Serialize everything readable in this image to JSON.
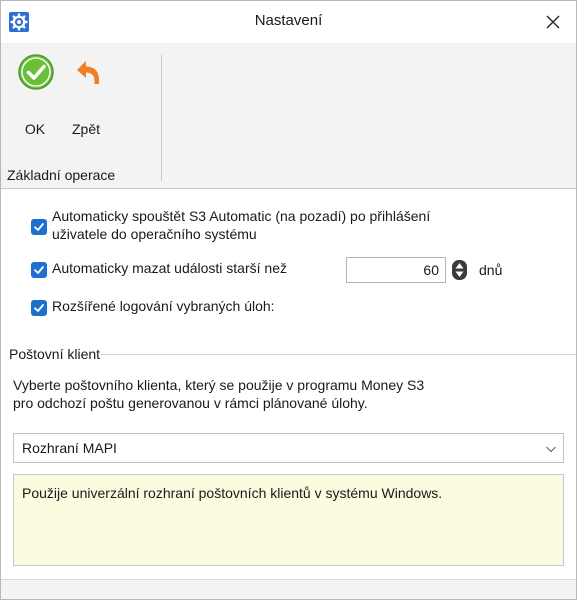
{
  "window": {
    "title": "Nastavení"
  },
  "ribbon": {
    "ok_label": "OK",
    "back_label": "Zpět",
    "group_label": "Základní operace"
  },
  "options": {
    "autostart_label_line1": "Automaticky spouštět S3 Automatic (na pozadí) po přihlášení",
    "autostart_label_line2": "uživatele do operačního systému",
    "autostart_checked": true,
    "auto_delete_label": "Automaticky mazat události starší než",
    "auto_delete_checked": true,
    "auto_delete_days": "60",
    "auto_delete_unit": "dnů",
    "extended_logging_label": "Rozšířené logování vybraných úloh:",
    "extended_logging_checked": true
  },
  "mail_client": {
    "section_title": "Poštovní klient",
    "description_line1": "Vyberte poštovního klienta, který se použije v programu Money S3",
    "description_line2": "pro odchozí poštu generovanou v rámci plánované úlohy.",
    "selected_client": "Rozhraní MAPI",
    "info_text": "Použije univerzální rozhraní poštovních klientů v systému Windows."
  },
  "icons": {
    "app": "settings-gear-icon",
    "close": "close-icon",
    "ok": "check-circle-icon",
    "back": "undo-arrow-icon",
    "checkbox": "checkmark-icon",
    "spinner": "spinner-arrows-icon",
    "dropdown": "chevron-down-icon"
  },
  "colors": {
    "accent": "#1f6fce",
    "ok_green": "#6abf3a",
    "back_orange": "#f07f26",
    "info_background": "#fcfbdf",
    "ribbon_background": "#f3f3f3"
  }
}
